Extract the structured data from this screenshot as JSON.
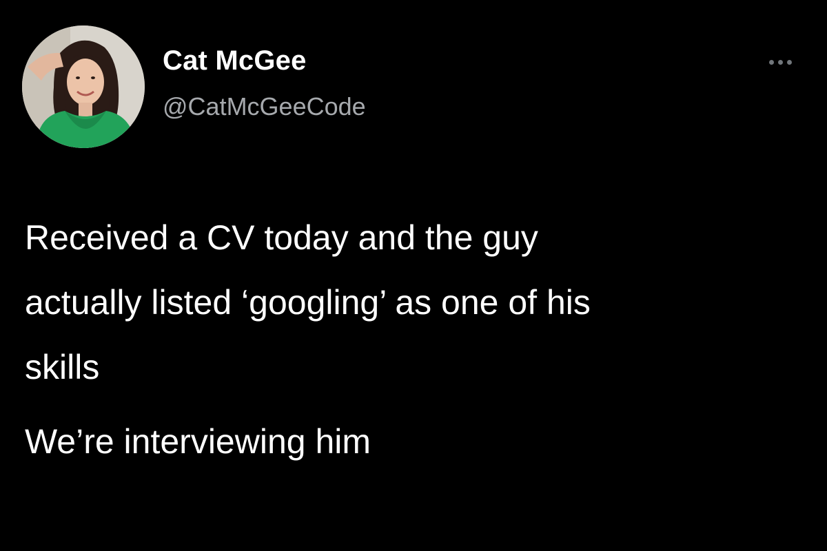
{
  "author": {
    "display_name": "Cat McGee",
    "handle": "@CatMcGeeCode",
    "avatar_icon": "profile-photo"
  },
  "menu": {
    "icon": "more-horizontal-icon"
  },
  "tweet": {
    "paragraph_1": [
      "Received a CV today and the guy",
      "actually listed ‘googling’ as one of his",
      "skills"
    ],
    "paragraph_2": [
      "We’re interviewing him"
    ]
  },
  "colors": {
    "background": "#000000",
    "text": "#ffffff",
    "handle": "#a6a9ad",
    "muted_icon": "#71767b",
    "avatar_shirt": "#22a35a"
  }
}
